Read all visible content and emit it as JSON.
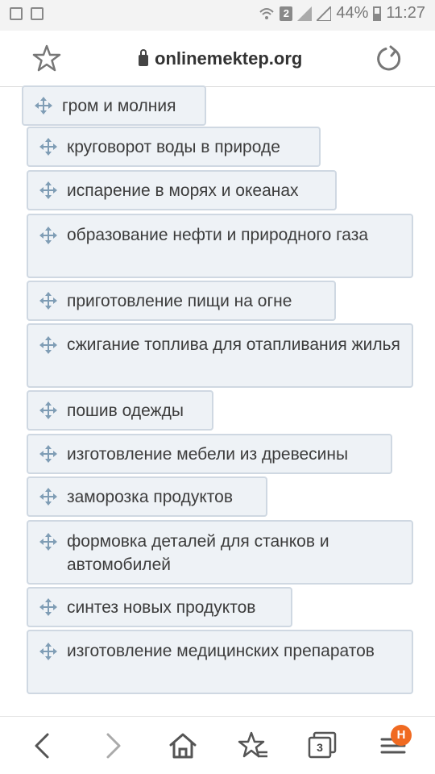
{
  "status_bar": {
    "sim_slot": "2",
    "battery": "44%",
    "time": "11:27"
  },
  "browser": {
    "url": "onlinemektep.org"
  },
  "items": [
    {
      "label": "гром и молния"
    },
    {
      "label": "круговорот воды в природе"
    },
    {
      "label": "испарение в морях и океанах"
    },
    {
      "label": "образование нефти и природного газа"
    },
    {
      "label": "приготовление пищи на огне"
    },
    {
      "label": "сжигание топлива для отапливания жилья"
    },
    {
      "label": "пошив одежды"
    },
    {
      "label": "изготовление мебели из древесины"
    },
    {
      "label": "заморозка продуктов"
    },
    {
      "label": "формовка деталей для станков и автомобилей"
    },
    {
      "label": "синтез новых продуктов"
    },
    {
      "label": "изготовление медицинских препаратов"
    }
  ],
  "bottom_bar": {
    "tabs_count": "3",
    "menu_badge": "Н"
  },
  "icons": {
    "drag_handle": "move-arrows-icon",
    "accent": "#f06a21",
    "item_bg": "#eef2f6",
    "item_border": "#cfd8e2"
  }
}
